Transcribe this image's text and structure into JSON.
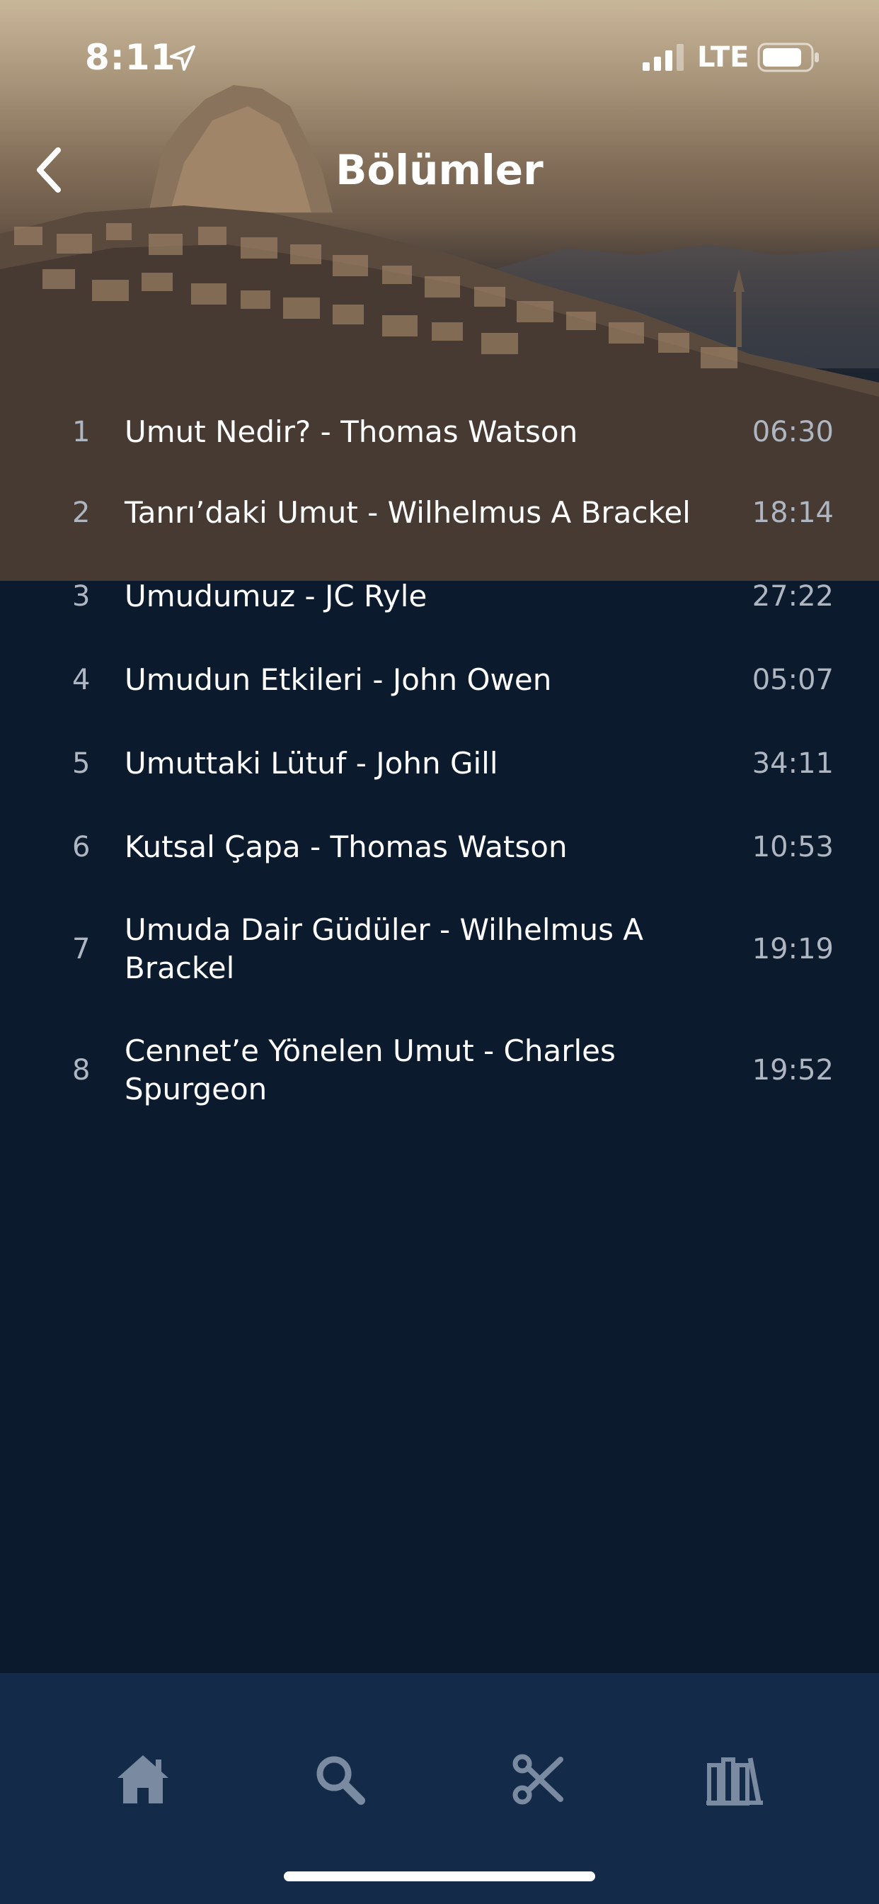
{
  "status_bar": {
    "time": "8:11",
    "network": "LTE"
  },
  "header": {
    "title": "Bölümler"
  },
  "episodes": [
    {
      "number": "1",
      "title": "Umut Nedir? - Thomas Watson",
      "duration": "06:30"
    },
    {
      "number": "2",
      "title": "Tanrı’daki Umut - Wilhelmus A Brackel",
      "duration": "18:14"
    },
    {
      "number": "3",
      "title": "Umudumuz - JC Ryle",
      "duration": "27:22"
    },
    {
      "number": "4",
      "title": "Umudun Etkileri - John Owen",
      "duration": "05:07"
    },
    {
      "number": "5",
      "title": "Umuttaki Lütuf - John Gill",
      "duration": "34:11"
    },
    {
      "number": "6",
      "title": "Kutsal Çapa - Thomas Watson",
      "duration": "10:53"
    },
    {
      "number": "7",
      "title": "Umuda Dair Güdüler - Wilhelmus A Brackel",
      "duration": "19:19"
    },
    {
      "number": "8",
      "title": "Cennet’e Yönelen Umut - Charles Spurgeon",
      "duration": "19:52"
    }
  ],
  "tab_bar": {
    "icons": [
      "home-icon",
      "search-icon",
      "scissors-icon",
      "library-icon"
    ]
  },
  "colors": {
    "background": "#0b1a2c",
    "tab_bar": "#132a48",
    "secondary_text": "#aeb6c2"
  }
}
